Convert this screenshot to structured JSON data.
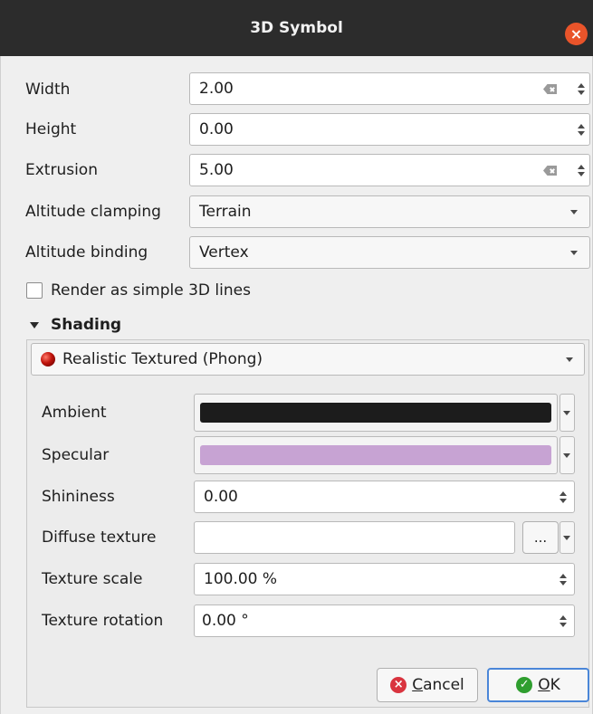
{
  "window": {
    "title": "3D Symbol",
    "close_icon": "close-icon"
  },
  "form": {
    "width": {
      "label": "Width",
      "value": "2.00"
    },
    "height": {
      "label": "Height",
      "value": "0.00"
    },
    "extrusion": {
      "label": "Extrusion",
      "value": "5.00"
    },
    "altitude_clamping": {
      "label": "Altitude clamping",
      "value": "Terrain"
    },
    "altitude_binding": {
      "label": "Altitude binding",
      "value": "Vertex"
    },
    "simple_lines": {
      "label": "Render as simple 3D lines",
      "checked": false
    }
  },
  "shading": {
    "section_label": "Shading",
    "mode": "Realistic Textured (Phong)",
    "ambient": {
      "label": "Ambient",
      "color": "#1c1c1c"
    },
    "specular": {
      "label": "Specular",
      "color": "#c7a3d3"
    },
    "shininess": {
      "label": "Shininess",
      "value": "0.00"
    },
    "diffuse_texture": {
      "label": "Diffuse texture",
      "value": "",
      "browse_label": "..."
    },
    "texture_scale": {
      "label": "Texture scale",
      "value": "100.00 %"
    },
    "texture_rotation": {
      "label": "Texture rotation",
      "value": "0.00 °"
    }
  },
  "buttons": {
    "cancel_mnemonic": "C",
    "cancel_rest": "ancel",
    "ok_mnemonic": "O",
    "ok_rest": "K"
  },
  "colors": {
    "title_bar": "#2c2c2c",
    "close_button": "#e9542a",
    "ok_border": "#4a86d8"
  }
}
